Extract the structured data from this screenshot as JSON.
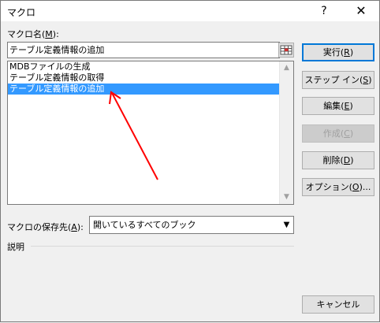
{
  "window": {
    "title": "マクロ",
    "help_button": "?",
    "close_button": "✕"
  },
  "macro_name": {
    "label_prefix": "マクロ名(",
    "label_mnemonic": "M",
    "label_suffix": "):",
    "value": "テーブル定義情報の追加"
  },
  "macro_list": {
    "items": [
      {
        "label": "MDBファイルの生成",
        "selected": false
      },
      {
        "label": "テーブル定義情報の取得",
        "selected": false
      },
      {
        "label": "テーブル定義情報の追加",
        "selected": true
      }
    ]
  },
  "buttons": {
    "run": {
      "prefix": "実行(",
      "mnemonic": "R",
      "suffix": ")"
    },
    "step_into": {
      "prefix": "ステップ イン(",
      "mnemonic": "S",
      "suffix": ")"
    },
    "edit": {
      "prefix": "編集(",
      "mnemonic": "E",
      "suffix": ")"
    },
    "create": {
      "prefix": "作成(",
      "mnemonic": "C",
      "suffix": ")"
    },
    "delete": {
      "prefix": "削除(",
      "mnemonic": "D",
      "suffix": ")"
    },
    "options": {
      "prefix": "オプション(",
      "mnemonic": "O",
      "suffix": ")..."
    },
    "cancel": "キャンセル"
  },
  "macros_in": {
    "label_prefix": "マクロの保存先(",
    "label_mnemonic": "A",
    "label_suffix": "):",
    "value": "開いているすべてのブック"
  },
  "description": {
    "label": "説明"
  },
  "colors": {
    "selection": "#3399ff",
    "annotation_arrow": "#ff0000",
    "default_button_border": "#0078d7"
  }
}
